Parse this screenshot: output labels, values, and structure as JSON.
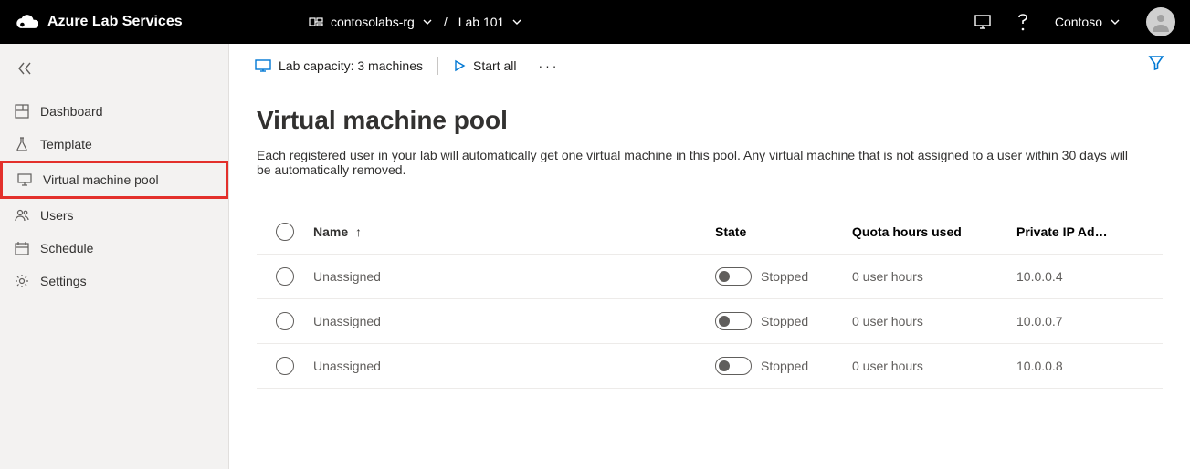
{
  "brand": {
    "name": "Azure Lab Services"
  },
  "breadcrumb": {
    "rg": "contosolabs-rg",
    "lab": "Lab 101"
  },
  "topbar": {
    "directory": "Contoso"
  },
  "sidebar": {
    "items": [
      {
        "label": "Dashboard"
      },
      {
        "label": "Template"
      },
      {
        "label": "Virtual machine pool"
      },
      {
        "label": "Users"
      },
      {
        "label": "Schedule"
      },
      {
        "label": "Settings"
      }
    ]
  },
  "toolbar": {
    "capacity": "Lab capacity: 3 machines",
    "start_all": "Start all"
  },
  "page": {
    "title": "Virtual machine pool",
    "description": "Each registered user in your lab will automatically get one virtual machine in this pool. Any virtual machine that is not assigned to a user within 30 days will be automatically removed."
  },
  "table": {
    "columns": {
      "name": "Name",
      "state": "State",
      "quota": "Quota hours used",
      "ip": "Private IP Ad…"
    },
    "rows": [
      {
        "name": "Unassigned",
        "state": "Stopped",
        "quota": "0 user hours",
        "ip": "10.0.0.4"
      },
      {
        "name": "Unassigned",
        "state": "Stopped",
        "quota": "0 user hours",
        "ip": "10.0.0.7"
      },
      {
        "name": "Unassigned",
        "state": "Stopped",
        "quota": "0 user hours",
        "ip": "10.0.0.8"
      }
    ]
  }
}
